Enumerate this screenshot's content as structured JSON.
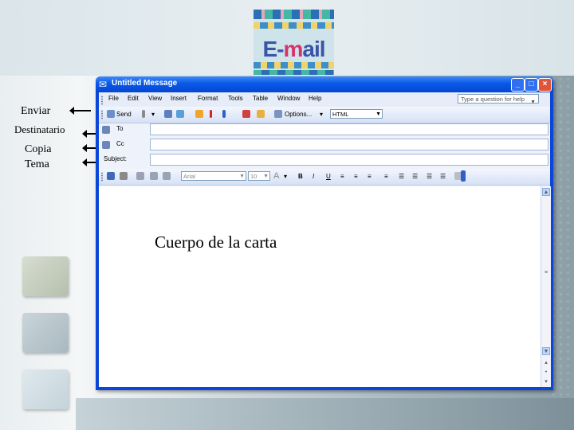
{
  "window": {
    "title": "Untitled Message"
  },
  "menu": [
    "File",
    "Edit",
    "View",
    "Insert",
    "Format",
    "Tools",
    "Table",
    "Window",
    "Help"
  ],
  "help_box": {
    "placeholder": "Type a question for help"
  },
  "toolbar": {
    "send_label": "Send",
    "options_label": "Options...",
    "format_value": "HTML"
  },
  "fields": {
    "to_label": "To",
    "cc_label": "Cc",
    "subject_label": "Subject:"
  },
  "format_bar": {
    "font_value": "Arial",
    "size_value": "10",
    "bold": "B",
    "italic": "I",
    "underline": "U"
  },
  "body": {
    "text": "Cuerpo de la carta"
  },
  "annotations": {
    "send": "Enviar",
    "recipient": "Destinatario",
    "copy": "Copia",
    "subject": "Tema"
  },
  "logo": {
    "text_e": "E-",
    "text_m": "m",
    "text_rest": "ail"
  }
}
